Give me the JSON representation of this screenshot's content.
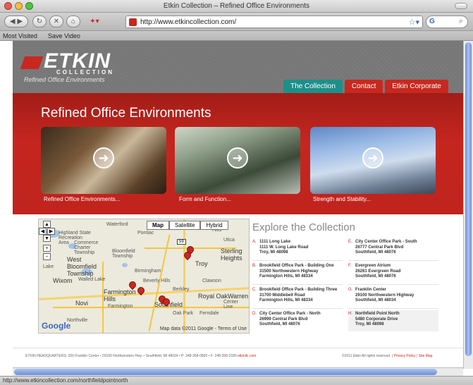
{
  "window": {
    "title": "Etkin Collection – Refined Office Environments"
  },
  "toolbar": {
    "url": "http://www.etkincollection.com/",
    "search_engine": "G"
  },
  "bookmarks": [
    "Most Visited",
    "Save Video"
  ],
  "site": {
    "logo": "ETKIN",
    "logo_sub": "COLLECTION",
    "tagline": "Refined Office Environments",
    "nav": [
      "The Collection",
      "Contact",
      "Etkin Corporate"
    ],
    "hero_title": "Refined Office Environments",
    "cards": [
      {
        "label": "Refined Office Environments..."
      },
      {
        "label": "Form and Function..."
      },
      {
        "label": "Strength and Stability..."
      }
    ]
  },
  "map": {
    "types": [
      "Map",
      "Satellite",
      "Hybrid"
    ],
    "towns": [
      "Waterford",
      "Pontiac",
      "Highland State Recreation Area",
      "Commerce Charter Township",
      "West Bloomfield Township",
      "Bloomfield Township",
      "Sterling Heights",
      "Utica",
      "Troy",
      "Birmingham",
      "Wixom",
      "Walled Lake",
      "Beverly Hills",
      "Farmington Hills",
      "Berkley",
      "Royal Oak",
      "Warren",
      "Novi",
      "Southfield",
      "Farmington",
      "Oak Park",
      "Ferndale",
      "Northville",
      "Clawson",
      "Center Line",
      "Hills",
      "Lake"
    ],
    "route_number": "59",
    "data_credit": "Map data ©2011 Google - Terms of Use",
    "logo": "Google"
  },
  "explore": {
    "title": "Explore the Collection",
    "locations": [
      {
        "letter": "A.",
        "lines": [
          "1111 Long Lake",
          "1111 W. Long Lake Road",
          "Troy, MI 48098"
        ]
      },
      {
        "letter": "B.",
        "lines": [
          "Brookfield Office Park - Building One",
          "31500 Northwestern Highway",
          "Farmington Hills, MI 48334"
        ]
      },
      {
        "letter": "C.",
        "lines": [
          "Brookfield Office Park - Building Three",
          "31700 Middlebelt Road",
          "Farmington Hills, MI 48334"
        ]
      },
      {
        "letter": "D.",
        "lines": [
          "City Center Office Park - North",
          "26999 Central Park Blvd",
          "Southfield, MI 48076"
        ]
      },
      {
        "letter": "E.",
        "lines": [
          "City Center Office Park - South",
          "26777 Central Park Blvd",
          "Southfield, MI 48076"
        ]
      },
      {
        "letter": "F.",
        "lines": [
          "Evergreen Atrium",
          "26261 Evergreen Road",
          "Southfield, MI 48076"
        ]
      },
      {
        "letter": "G.",
        "lines": [
          "Franklin Center",
          "29100 Northwestern Highway",
          "Southfield, MI 48034"
        ]
      },
      {
        "letter": "H.",
        "lines": [
          "Northfield Point North",
          "5480 Corporate Drive",
          "Troy, MI 48098"
        ]
      }
    ]
  },
  "footer": {
    "left": "ETKIN HEADQUARTERS: 200 Franklin Center • 29100 Northwestern Hwy. • Southfield, MI 48034 • P: 248-358-0800 • F: 248-358-2180",
    "left_link": "etkinllc.com",
    "right": "©2011 Etkin All rights reserved. |",
    "privacy": "Privacy Policy",
    "divider": "|",
    "sitemap": "Site Map"
  },
  "status": {
    "text": "http://www.etkincollection.com/northfieldpointnorth"
  },
  "colors": {
    "brand_red": "#c8281e",
    "active_teal": "#1d8f8a",
    "header_gray": "#7a7a7a"
  }
}
